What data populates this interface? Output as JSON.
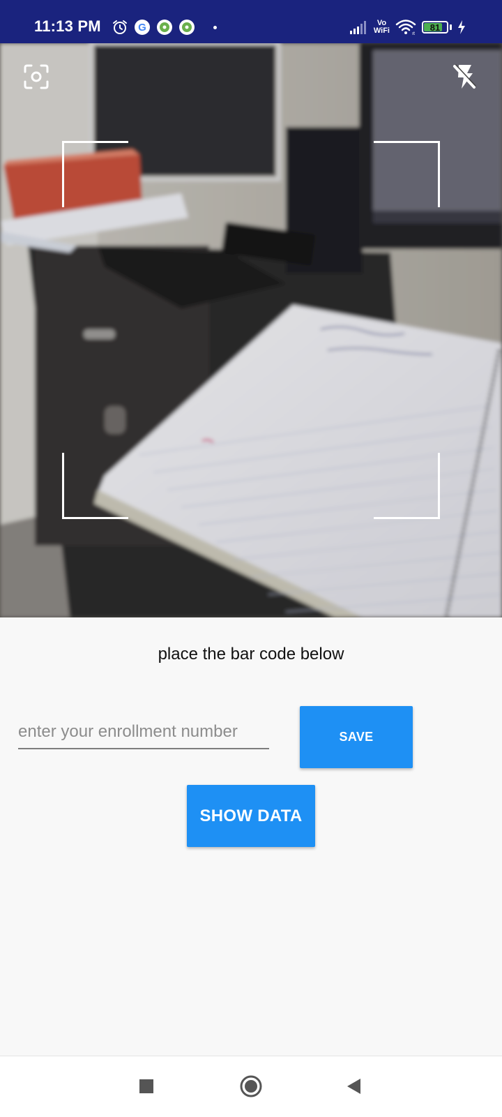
{
  "status_bar": {
    "time": "11:13 PM",
    "network_label_top": "Vo",
    "network_label_bottom": "WiFi",
    "battery_level": "81",
    "icons": [
      "alarm-icon",
      "google-icon",
      "app-notification-icon",
      "app-notification-icon",
      "signal-icon",
      "wifi-icon",
      "battery-icon",
      "charging-icon"
    ]
  },
  "camera": {
    "left_control_icon": "camera-switch-icon",
    "right_control_icon": "flash-off-icon"
  },
  "scanner": {
    "instruction": "place the bar code below",
    "enrollment_placeholder": "enter your enrollment number",
    "enrollment_value": "",
    "save_label": "SAVE",
    "show_data_label": "SHOW DATA"
  },
  "navigation": {
    "recents_icon": "square-icon",
    "home_icon": "circle-icon",
    "back_icon": "triangle-back-icon"
  },
  "colors": {
    "status_bar": "#1a237e",
    "accent": "#1e90f4",
    "background": "#f8f8f8",
    "battery_fill": "#4caf50"
  }
}
